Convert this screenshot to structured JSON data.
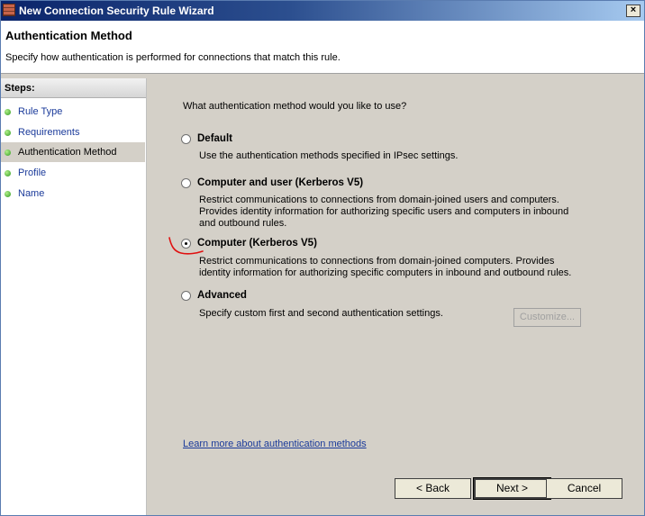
{
  "window": {
    "title": "New Connection Security Rule Wizard",
    "close_label": "×"
  },
  "header": {
    "title": "Authentication Method",
    "subtitle": "Specify how authentication is performed for connections that match this rule."
  },
  "steps": {
    "title": "Steps:",
    "items": [
      {
        "label": "Rule Type",
        "current": false
      },
      {
        "label": "Requirements",
        "current": false
      },
      {
        "label": "Authentication Method",
        "current": true
      },
      {
        "label": "Profile",
        "current": false
      },
      {
        "label": "Name",
        "current": false
      }
    ]
  },
  "main": {
    "question": "What authentication method would you like to use?",
    "options": [
      {
        "label": "Default",
        "checked": false,
        "description": "Use the authentication methods specified in IPsec settings."
      },
      {
        "label": "Computer and user (Kerberos V5)",
        "checked": false,
        "description": "Restrict communications to connections from domain-joined users and computers. Provides identity information for authorizing specific users and computers in inbound and outbound rules."
      },
      {
        "label": "Computer (Kerberos V5)",
        "checked": true,
        "description": "Restrict communications to connections from domain-joined computers.  Provides identity information for authorizing specific computers in inbound and outbound rules."
      },
      {
        "label": "Advanced",
        "checked": false,
        "description": "Specify custom first and second authentication settings."
      }
    ],
    "customize_label": "Customize...",
    "learn_more": "Learn more about authentication methods"
  },
  "buttons": {
    "back": "< Back",
    "next": "Next >",
    "cancel": "Cancel"
  },
  "colors": {
    "link": "#1a3a9a",
    "annotation": "#e01010"
  }
}
